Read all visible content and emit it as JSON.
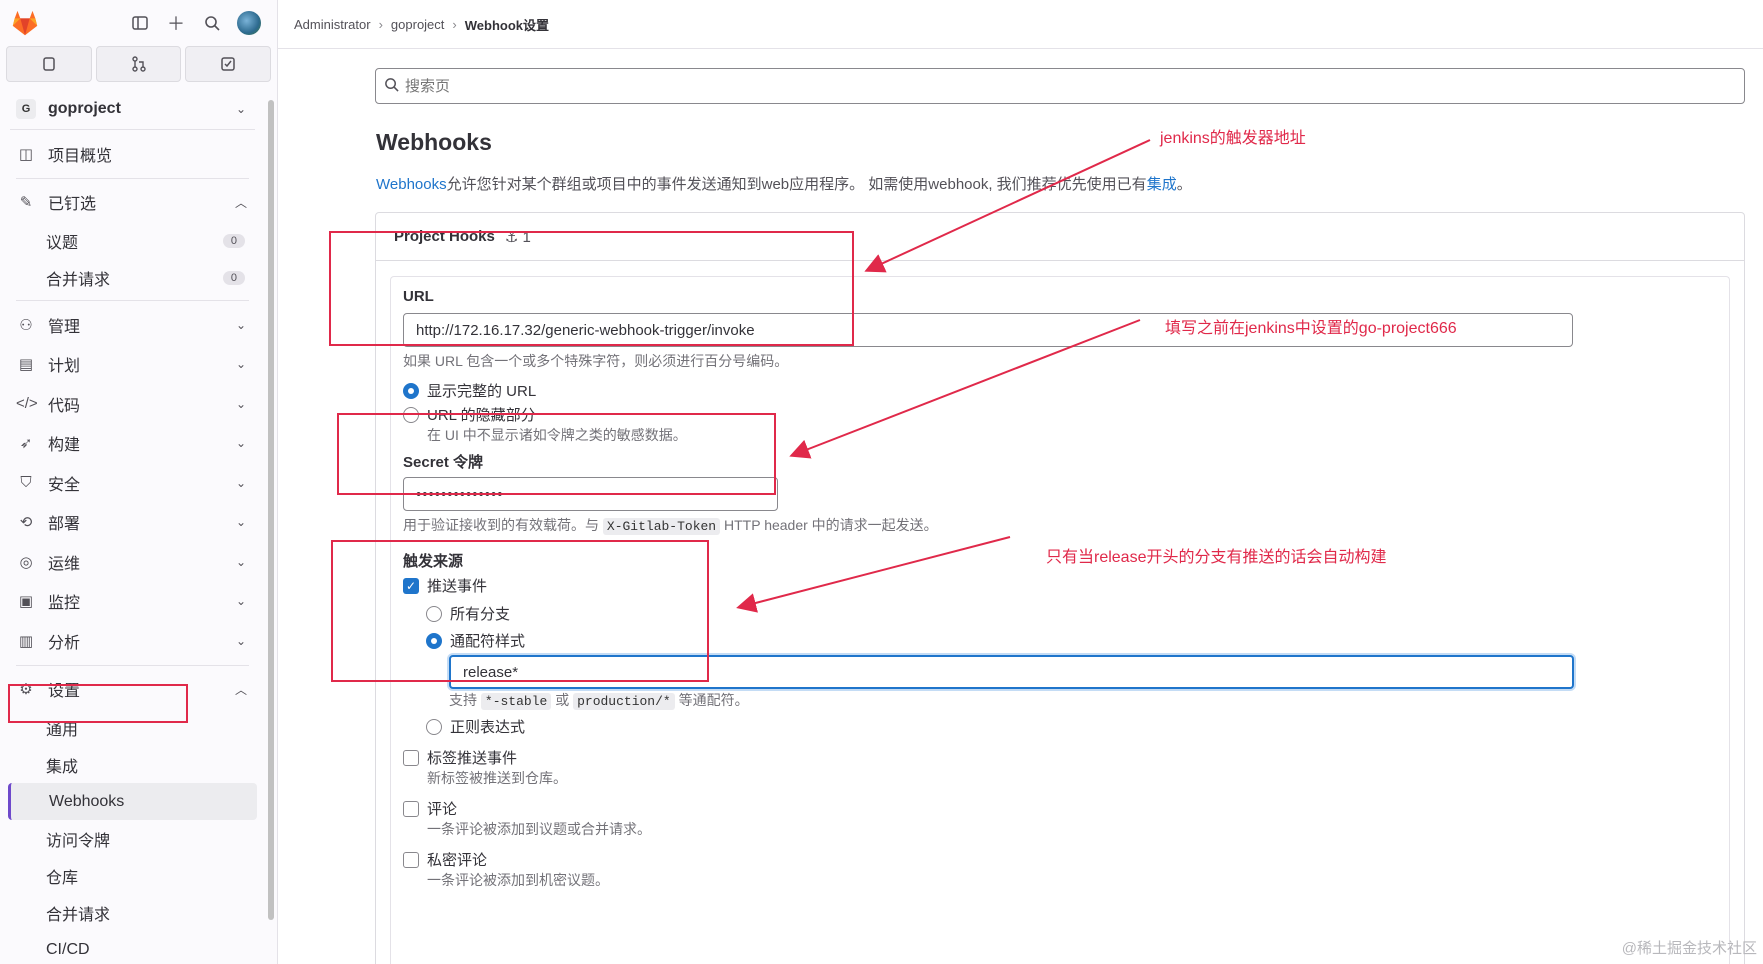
{
  "breadcrumb": [
    "Administrator",
    "goproject",
    "Webhook设置"
  ],
  "sidebar": {
    "project": {
      "badge": "G",
      "name": "goproject"
    },
    "items": [
      {
        "label": "项目概览",
        "icon": "overview-icon"
      },
      {
        "label": "已钉选",
        "icon": "pin-icon"
      },
      {
        "label": "管理",
        "icon": "manage-icon"
      },
      {
        "label": "计划",
        "icon": "plan-icon"
      },
      {
        "label": "代码",
        "icon": "code-icon"
      },
      {
        "label": "构建",
        "icon": "rocket-icon"
      },
      {
        "label": "安全",
        "icon": "shield-icon"
      },
      {
        "label": "部署",
        "icon": "deploy-icon"
      },
      {
        "label": "运维",
        "icon": "monitor-icon"
      },
      {
        "label": "监控",
        "icon": "chart-icon"
      },
      {
        "label": "分析",
        "icon": "analytics-icon"
      },
      {
        "label": "设置",
        "icon": "gear-icon"
      }
    ],
    "pinned": [
      {
        "label": "议题",
        "count": "0"
      },
      {
        "label": "合并请求",
        "count": "0"
      }
    ],
    "settings": [
      "通用",
      "集成",
      "Webhooks",
      "访问令牌",
      "仓库",
      "合并请求",
      "CI/CD"
    ]
  },
  "search": {
    "placeholder": "搜索页"
  },
  "page": {
    "title": "Webhooks",
    "desc_link": "Webhooks",
    "desc_text": "允许您针对某个群组或项目中的事件发送通知到web应用程序。 如需使用webhook, 我们推荐优先使用已有",
    "desc_link2": "集成",
    "desc_end": "。"
  },
  "card": {
    "title": "Project Hooks",
    "hook_count": "1",
    "url_label": "URL",
    "url_value": "http://172.16.17.32/generic-webhook-trigger/invoke",
    "url_help": "如果 URL 包含一个或多个特殊字符，则必须进行百分号编码。",
    "show_full_url": "显示完整的 URL",
    "mask_url": "URL 的隐藏部分",
    "mask_help": "在 UI 中不显示诸如令牌之类的敏感数据。",
    "secret_label": "Secret 令牌",
    "secret_value": "••••••••••••••",
    "secret_help_1": "用于验证接收到的有效载荷。与",
    "secret_help_code": "X-Gitlab-Token",
    "secret_help_2": "HTTP header 中的请求一起发送。",
    "trigger_label": "触发来源",
    "push_events": "推送事件",
    "all_branches": "所有分支",
    "wildcard": "通配符样式",
    "wildcard_value": "release*",
    "wildcard_help_1": "支持",
    "wildcard_code_1": "*-stable",
    "wildcard_help_2": "或",
    "wildcard_code_2": "production/*",
    "wildcard_help_3": "等通配符。",
    "regex": "正则表达式",
    "tag_push": "标签推送事件",
    "tag_push_help": "新标签被推送到仓库。",
    "comments": "评论",
    "comments_help": "一条评论被添加到议题或合并请求。",
    "confidential_comments": "私密评论",
    "confidential_help": "一条评论被添加到机密议题。"
  },
  "annotations": {
    "a1": "jenkins的触发器地址",
    "a2": "填写之前在jenkins中设置的go-project666",
    "a3": "只有当release开头的分支有推送的话会自动构建",
    "color": "#e0294a"
  },
  "watermark": "@稀土掘金技术社区"
}
